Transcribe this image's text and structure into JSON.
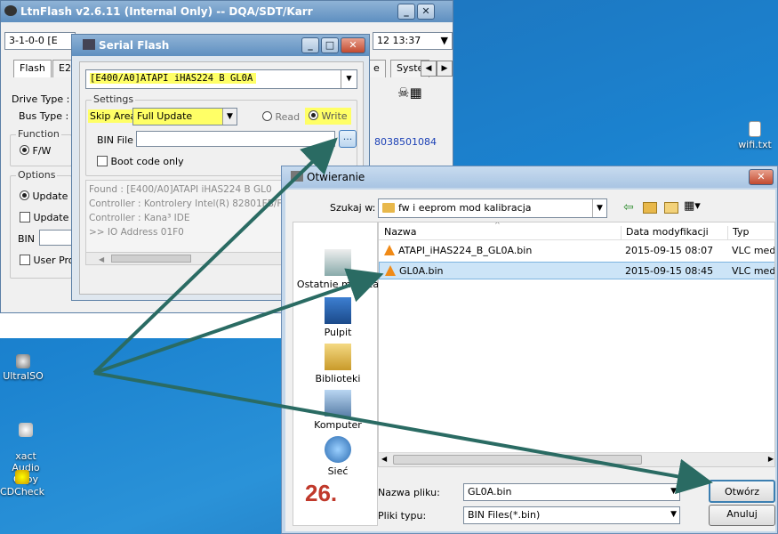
{
  "ltn": {
    "title": "LtnFlash v2.6.11 (Internal Only) -- DQA/SDT/Karr",
    "dev_field": "3-1-0-0  [E",
    "time_field": "12 13:37",
    "tabs": [
      "Flash",
      "E2",
      "e",
      "Syste"
    ],
    "drive_type": "Drive Type :",
    "bus_type": "Bus Type :",
    "function": "Function",
    "fw": "F/W",
    "options": "Options",
    "update": "Update",
    "update_b": "Update I",
    "bin": "BIN",
    "user_pro": "User Pro",
    "serial": "8038501084"
  },
  "serial": {
    "title": "Serial Flash",
    "device": "[E400/A0]ATAPI   iHAS224   B     GL0A",
    "settings": "Settings",
    "skip_area": "Skip Area",
    "skip_value": "Full Update",
    "read": "Read",
    "write": "Write",
    "bin_file": "BIN File",
    "browse": "...",
    "boot_only": "Boot code only",
    "log": [
      "Found : [E400/A0]ATAPI  iHAS224  B   GL0",
      "Controller : Kontrolery Intel(R) 82801FB/FBM",
      "Controller : Kana³ IDE",
      ">> IO Address 01F0"
    ]
  },
  "open": {
    "title": "Otwieranie",
    "look_in_label": "Szukaj w:",
    "look_in": "fw i eeprom mod kalibracja",
    "places": [
      "Ostatnie miejsca",
      "Pulpit",
      "Biblioteki",
      "Komputer",
      "Sieć"
    ],
    "columns": [
      "Nazwa",
      "Data modyfikacji",
      "Typ"
    ],
    "files": [
      {
        "name": "ATAPI_iHAS224_B_GL0A.bin",
        "date": "2015-09-15 08:07",
        "type": "VLC medi"
      },
      {
        "name": "GL0A.bin",
        "date": "2015-09-15 08:45",
        "type": "VLC medi"
      }
    ],
    "filename_label": "Nazwa pliku:",
    "filename": "GL0A.bin",
    "filetype_label": "Pliki typu:",
    "filetype": "BIN Files(*.bin)",
    "open_btn": "Otwórz",
    "cancel_btn": "Anuluj",
    "step": "26."
  },
  "desktop": {
    "icons": [
      "UltraISO",
      "xact Audio\nCopy",
      "CDCheck"
    ],
    "file": "wifi.txt"
  },
  "colors": {
    "highlight": "#ffff66",
    "arrow": "#2a6b63",
    "step": "#c0392b",
    "selected": "#cce4f7"
  }
}
